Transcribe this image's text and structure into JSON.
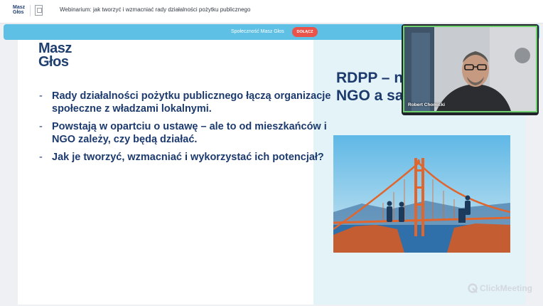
{
  "header": {
    "logo_line1": "Masz",
    "logo_line2": "Głos",
    "title": "Webinarium: jak tworzyć i wzmacniać rady działalności pożytku publicznego",
    "emblem_icon": "coat-of-arms-icon"
  },
  "banner": {
    "text": "Społeczność Masz Głos",
    "join_label": "DOŁĄCZ",
    "color": "#5ec0e4",
    "button_color": "#e9534a"
  },
  "slide": {
    "logo_line1": "Masz",
    "logo_line2": "Głos",
    "title_line1": "RDPP – n",
    "title_line2": "NGO a sa",
    "bullets": [
      "Rady działalności pożytku publicznego łączą organizacje społeczne z władzami lokalnymi.",
      "Powstają w opartciu o ustawę – ale to od mieszkańców i NGO zależy, czy będą działać.",
      "Jak je tworzyć, wzmacniać i wykorzystać ich potencjał?"
    ],
    "bullet_marker": "-",
    "illustration": "bridge-illustration",
    "text_color": "#1c3a6e",
    "accent_color": "#e85b45"
  },
  "video": {
    "speaker_name": "Robert Chomicki",
    "active_border_color": "#6ed26e"
  },
  "watermark": {
    "brand": "ClickMeeting",
    "icon": "clickmeeting-logo-icon"
  }
}
